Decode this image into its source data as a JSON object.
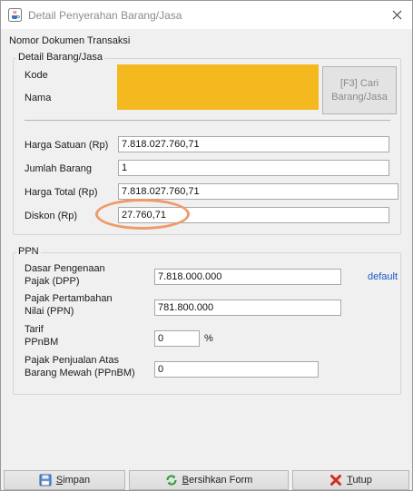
{
  "window": {
    "title": "Detail Penyerahan Barang/Jasa"
  },
  "header": {
    "nomor_label": "Nomor Dokumen Transaksi"
  },
  "detail_group": {
    "legend": "Detail Barang/Jasa",
    "kode_label": "Kode",
    "nama_label": "Nama",
    "lookup_button": {
      "line1": "[F3] Cari",
      "line2": "Barang/Jasa"
    },
    "highlight_color": "#f3b91f",
    "harga_satuan_label": "Harga Satuan (Rp)",
    "harga_satuan_value": "7.818.027.760,71",
    "jumlah_label": "Jumlah Barang",
    "jumlah_value": "1",
    "harga_total_label": "Harga Total (Rp)",
    "harga_total_value": "7.818.027.760,71",
    "diskon_label": "Diskon (Rp)",
    "diskon_value": "27.760,71"
  },
  "ppn_group": {
    "legend": "PPN",
    "dpp_label_1": "Dasar Pengenaan",
    "dpp_label_2": "Pajak (DPP)",
    "dpp_value": "7.818.000.000",
    "default_link": "default",
    "ppn_label_1": "Pajak Pertambahan",
    "ppn_label_2": "Nilai (PPN)",
    "ppn_value": "781.800.000",
    "tarif_label_1": "Tarif",
    "tarif_label_2": "PPnBM",
    "tarif_value": "0",
    "percent": "%",
    "ppnbm_label_1": "Pajak Penjualan Atas",
    "ppnbm_label_2": "Barang Mewah (PPnBM)",
    "ppnbm_value": "0"
  },
  "buttons": {
    "simpan": {
      "mnemonic": "S",
      "rest": "impan"
    },
    "bersihkan": {
      "mnemonic": "B",
      "rest": "ersihkan Form"
    },
    "tutup": {
      "mnemonic": "T",
      "rest": "utup"
    }
  },
  "icons": {
    "app": "java-cup-icon",
    "close": "close-icon",
    "save": "floppy-disk-icon",
    "refresh": "refresh-icon",
    "cancel": "red-x-icon"
  }
}
